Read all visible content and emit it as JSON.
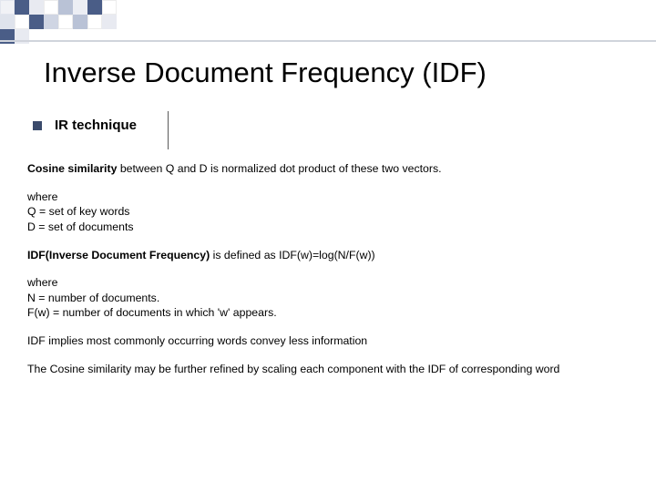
{
  "title": "Inverse Document Frequency (IDF)",
  "bullet1": "IR technique",
  "p1_a": "Cosine similarity",
  "p1_b": " between Q and D is normalized dot product  of these two vectors.",
  "defs1_where": "where",
  "defs1_q": "Q =  set of key words",
  "defs1_d": "D = set of documents",
  "p2_a": "IDF(Inverse Document Frequency)",
  "p2_b": " is defined as  IDF(w)=log(N/F(w))",
  "defs2_where": "where",
  "defs2_n": "N = number of documents.",
  "defs2_fw": "F(w) = number of documents in which 'w' appears.",
  "p3": "IDF implies  most commonly occurring words convey less information",
  "p4": "The Cosine similarity may be further  refined by scaling each component with the IDF  of corresponding word"
}
